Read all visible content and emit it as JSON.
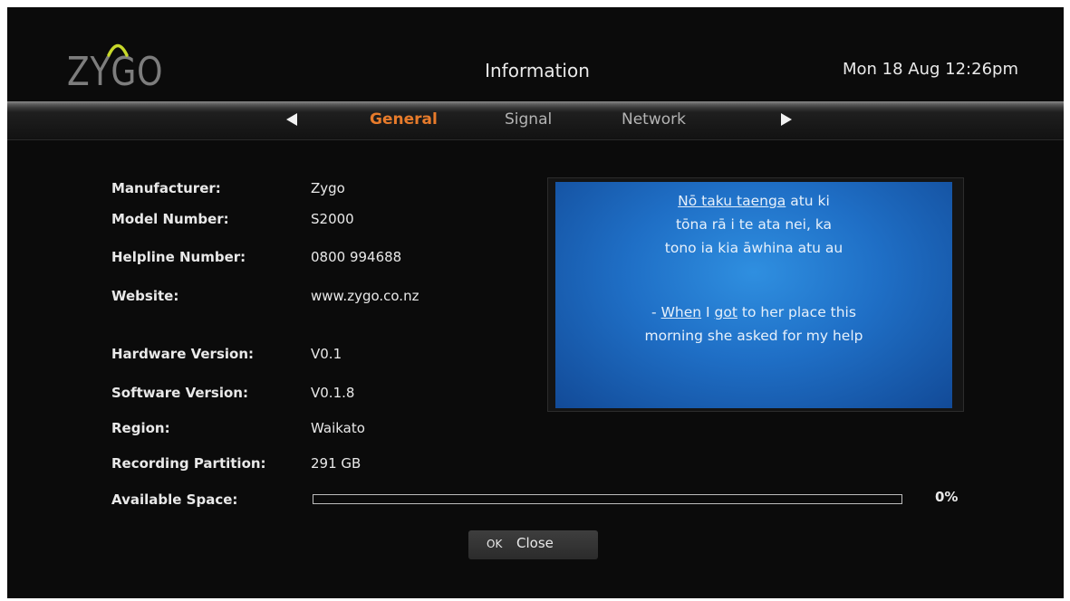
{
  "header": {
    "logo_text": "ZYGO",
    "title": "Information",
    "datetime": "Mon 18 Aug 12:26pm"
  },
  "tabs": {
    "items": [
      {
        "label": "General",
        "active": true
      },
      {
        "label": "Signal",
        "active": false
      },
      {
        "label": "Network",
        "active": false
      }
    ],
    "icons": {
      "prev": "triangle-left-icon",
      "next": "triangle-right-icon"
    }
  },
  "info": {
    "manufacturer": {
      "label": "Manufacturer:",
      "value": "Zygo"
    },
    "model_number": {
      "label": "Model Number:",
      "value": "S2000"
    },
    "helpline_number": {
      "label": "Helpline Number:",
      "value": "0800 994688"
    },
    "website": {
      "label": "Website:",
      "value": "www.zygo.co.nz"
    },
    "hardware_version": {
      "label": "Hardware Version:",
      "value": "V0.1"
    },
    "software_version": {
      "label": "Software Version:",
      "value": "V0.1.8"
    },
    "region": {
      "label": "Region:",
      "value": "Waikato"
    },
    "recording_partition": {
      "label": "Recording Partition:",
      "value": "291 GB"
    },
    "available_space": {
      "label": "Available Space:",
      "percent_text": "0%",
      "fraction": 0.0
    }
  },
  "preview": {
    "maori_line1_a": "Nō taku taenga",
    "maori_line1_b": " atu ki",
    "maori_line2": "tōna rā i te ata nei, ka",
    "maori_line3": "tono ia kia āwhina atu au",
    "english_line1_a": "- ",
    "english_line1_b": "When",
    "english_line1_c": " ",
    "english_line1_d": "I",
    "english_line1_e": " ",
    "english_line1_f": "got",
    "english_line1_g": " to her place this",
    "english_line2": "morning she asked for my help"
  },
  "footer": {
    "ok_label": "OK",
    "close_label": "Close"
  },
  "colors": {
    "accent": "#e77b2b",
    "background": "#0b0b0b",
    "text": "#e9e9e9"
  }
}
